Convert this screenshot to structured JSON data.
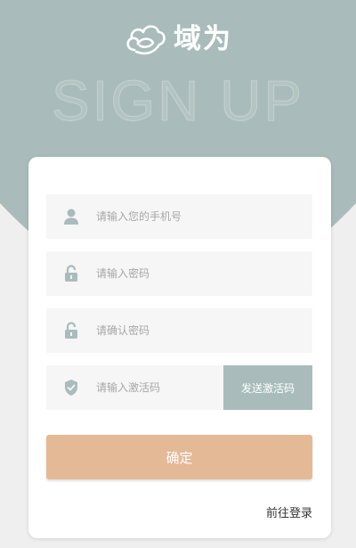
{
  "brand": {
    "name": "域为",
    "watermark": "SIGN UP"
  },
  "colors": {
    "header_bg": "#a9bcbb",
    "page_bg": "#efefef",
    "card_bg": "#ffffff",
    "field_bg": "#f6f6f6",
    "icon_color": "#a9bcbb",
    "code_button_bg": "#a9bcbb",
    "submit_button_bg": "#e4b996"
  },
  "form": {
    "phone": {
      "placeholder": "请输入您的手机号",
      "icon": "user-icon"
    },
    "password": {
      "placeholder": "请输入密码",
      "icon": "lock-icon"
    },
    "confirm_password": {
      "placeholder": "请确认密码",
      "icon": "lock-icon"
    },
    "activation_code": {
      "placeholder": "请输入激活码",
      "icon": "shield-check-icon"
    },
    "send_code_label": "发送激活码",
    "submit_label": "确定"
  },
  "footer": {
    "login_link": "前往登录"
  }
}
